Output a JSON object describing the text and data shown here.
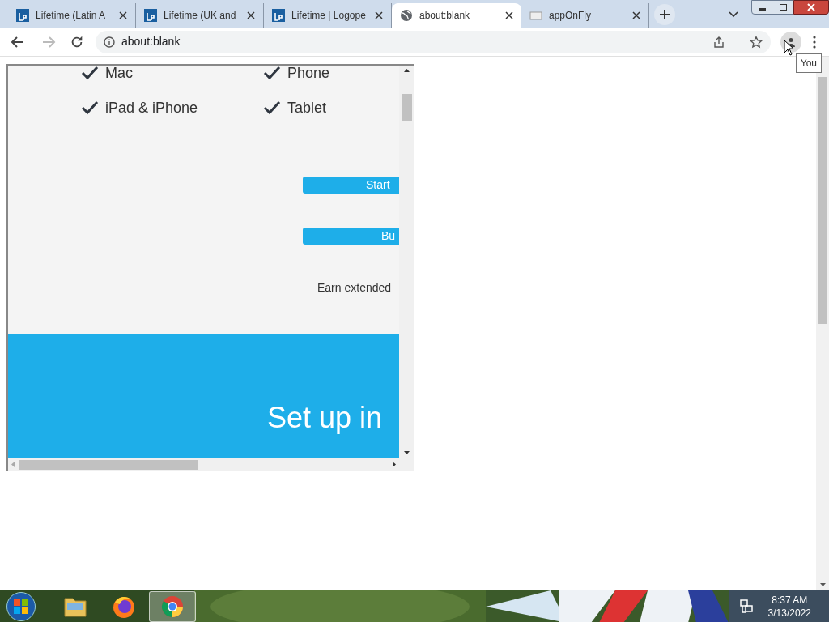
{
  "tabs": [
    {
      "label": "Lifetime (Latin A",
      "kind": "lp",
      "selected": false
    },
    {
      "label": "Lifetime (UK and",
      "kind": "lp",
      "selected": false
    },
    {
      "label": "Lifetime | Logope",
      "kind": "lp",
      "selected": false
    },
    {
      "label": "about:blank",
      "kind": "globe",
      "selected": true
    },
    {
      "label": "appOnFly",
      "kind": "page",
      "selected": false
    }
  ],
  "address_bar": {
    "url": "about:blank"
  },
  "tooltip": "You",
  "embedded_frame": {
    "features": [
      {
        "label": "Mac"
      },
      {
        "label": "Phone"
      },
      {
        "label": "iPad & iPhone"
      },
      {
        "label": "Tablet"
      }
    ],
    "buttons": [
      "Start",
      "Bu"
    ],
    "note": "Earn extended",
    "banner_heading": "Set up in"
  },
  "taskbar": {
    "apps": [
      {
        "kind": "folder",
        "selected": false
      },
      {
        "kind": "firefox",
        "selected": false
      },
      {
        "kind": "chrome",
        "selected": true
      }
    ],
    "time": "8:37 AM",
    "date": "3/13/2022"
  }
}
